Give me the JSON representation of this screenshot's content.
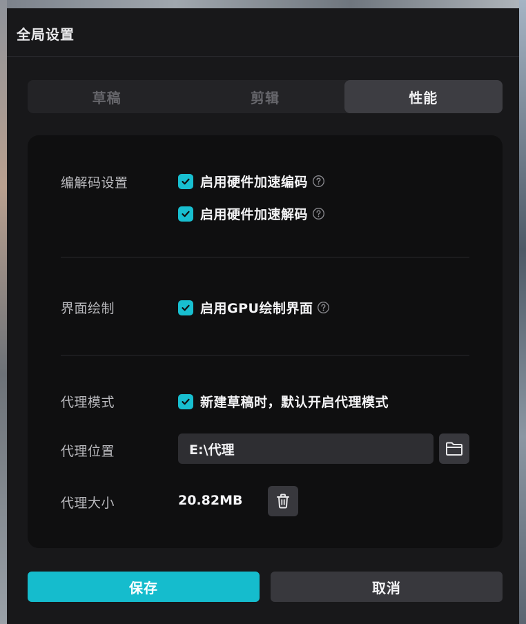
{
  "dialog": {
    "title": "全局设置"
  },
  "tabs": [
    {
      "label": "草稿",
      "active": false
    },
    {
      "label": "剪辑",
      "active": false
    },
    {
      "label": "性能",
      "active": true
    }
  ],
  "codec": {
    "label": "编解码设置",
    "options": [
      {
        "label": "启用硬件加速编码",
        "checked": true
      },
      {
        "label": "启用硬件加速解码",
        "checked": true
      }
    ]
  },
  "render": {
    "label": "界面绘制",
    "options": [
      {
        "label": "启用GPU绘制界面",
        "checked": true
      }
    ]
  },
  "proxy": {
    "mode_label": "代理模式",
    "mode_option": {
      "label": "新建草稿时，默认开启代理模式",
      "checked": true
    },
    "location_label": "代理位置",
    "location_value": "E:\\代理",
    "size_label": "代理大小",
    "size_value": "20.82MB"
  },
  "footer": {
    "save_label": "保存",
    "cancel_label": "取消"
  },
  "colors": {
    "accent": "#15bccd",
    "background": "#18181a",
    "panel": "#0f0f10"
  }
}
